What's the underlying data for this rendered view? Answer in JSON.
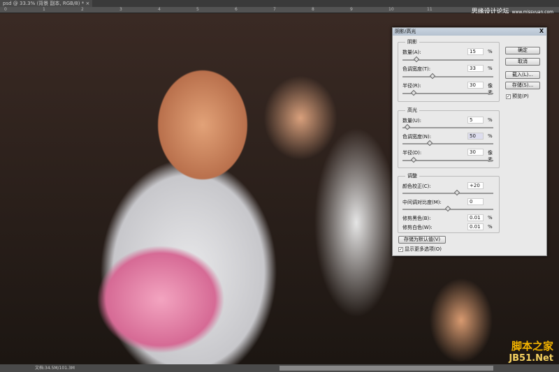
{
  "document": {
    "tab_title": "psd @ 33.3% (背景 副本, RGB/8) *",
    "close_glyph": "×",
    "status": "文档:34.5M/101.3M",
    "ruler_ticks": [
      "0",
      "1",
      "2",
      "3",
      "4",
      "5",
      "6",
      "7",
      "8",
      "9",
      "10",
      "11"
    ]
  },
  "watermarks": {
    "top": "思缘设计论坛",
    "top_url": "www.missyuan.com",
    "bottom_cn": "脚本之家",
    "bottom_en": "JB51.Net"
  },
  "dialog": {
    "title": "阴影/高光",
    "close": "X",
    "shadows": {
      "label": "阴影",
      "amount": {
        "label": "数量(A):",
        "value": "15",
        "unit": "%",
        "level": 0.15
      },
      "tonal_width": {
        "label": "色调宽度(T):",
        "value": "33",
        "unit": "%",
        "level": 0.33
      },
      "radius": {
        "label": "半径(R):",
        "value": "30",
        "unit": "像素",
        "level": 0.12
      }
    },
    "highlights": {
      "label": "高光",
      "amount": {
        "label": "数量(U):",
        "value": "5",
        "unit": "%",
        "level": 0.05
      },
      "tonal_width": {
        "label": "色调宽度(N):",
        "value": "50",
        "unit": "%",
        "level": 0.3
      },
      "radius": {
        "label": "半径(D):",
        "value": "30",
        "unit": "像素",
        "level": 0.12
      }
    },
    "adjustments": {
      "label": "调整",
      "color_correction": {
        "label": "颜色校正(C):",
        "value": "+20",
        "level": 0.6
      },
      "midtone_contrast": {
        "label": "中间调对比度(M):",
        "value": "0",
        "level": 0.5
      },
      "black_clip": {
        "label": "修剪黑色(B):",
        "value": "0.01",
        "unit": "%"
      },
      "white_clip": {
        "label": "修剪白色(W):",
        "value": "0.01",
        "unit": "%"
      }
    },
    "buttons": {
      "ok": "确定",
      "cancel": "取消",
      "load": "载入(L)...",
      "save": "存储(S)...",
      "save_default": "存储为默认值(V)"
    },
    "preview": {
      "label": "预览(P)",
      "checked": true
    },
    "show_more": {
      "label": "显示更多选项(O)",
      "checked": true
    }
  }
}
